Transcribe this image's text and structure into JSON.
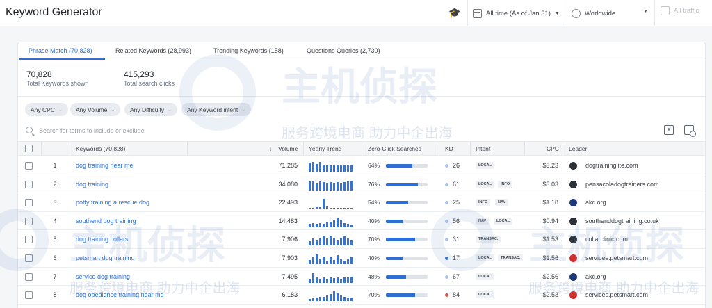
{
  "app": {
    "title": "Keyword Generator"
  },
  "topbar": {
    "date_label": "All time (As of Jan 31)",
    "region_label": "Worldwide",
    "traffic_label": "All traffic"
  },
  "tabs": [
    {
      "label": "Phrase Match (70,828)",
      "active": true
    },
    {
      "label": "Related Keywords (28,993)",
      "active": false
    },
    {
      "label": "Trending Keywords (158)",
      "active": false
    },
    {
      "label": "Questions Queries (2,730)",
      "active": false
    }
  ],
  "stats": [
    {
      "value": "70,828",
      "label": "Total Keywords shown"
    },
    {
      "value": "415,293",
      "label": "Total search clicks"
    }
  ],
  "filters": [
    "Any CPC",
    "Any Volume",
    "Any Difficulty",
    "Any Keyword intent"
  ],
  "search": {
    "placeholder": "Search for terms to include or exclude"
  },
  "table": {
    "headers": {
      "keywords": "Keywords (70,828)",
      "volume": "Volume",
      "trend": "Yearly Trend",
      "zero_click": "Zero-Click Searches",
      "kd": "KD",
      "intent": "Intent",
      "cpc": "CPC",
      "leader": "Leader"
    },
    "rows": [
      {
        "idx": "1",
        "keyword": "dog training near me",
        "volume": "71,285",
        "trend": [
          0.8,
          0.9,
          0.7,
          0.85,
          0.6,
          0.6,
          0.55,
          0.6,
          0.55,
          0.6,
          0.55,
          0.6,
          0.6
        ],
        "zc": "64%",
        "zc_value": 0.64,
        "kd": "26",
        "kd_color": "#a9c2e8",
        "intent": [
          "LOCAL"
        ],
        "cpc": "$3.23",
        "leader": "dogtraininglite.com",
        "leader_icon": "dogtraininglite-logo-icon",
        "leader_color": "#2b2f36"
      },
      {
        "idx": "2",
        "keyword": "dog training",
        "volume": "34,080",
        "trend": [
          0.8,
          0.85,
          0.7,
          0.8,
          0.75,
          0.7,
          0.75,
          0.7,
          0.75,
          0.7,
          0.75,
          0.8,
          0.85
        ],
        "zc": "76%",
        "zc_value": 0.76,
        "kd": "61",
        "kd_color": "#a9c2e8",
        "intent": [
          "LOCAL",
          "INFO"
        ],
        "cpc": "$3.03",
        "leader": "pensacoladogtrainers.com",
        "leader_icon": "pensacola-logo-icon",
        "leader_color": "#2b2f36"
      },
      {
        "idx": "3",
        "keyword": "potty training a rescue dog",
        "volume": "22,493",
        "trend": [
          0.05,
          0.05,
          0.1,
          0.15,
          0.9,
          0.2,
          0.05,
          0.05,
          0.05,
          0.05,
          0.05,
          0.05,
          0.05
        ],
        "zc": "54%",
        "zc_value": 0.54,
        "kd": "25",
        "kd_color": "#a9c2e8",
        "intent": [
          "INFO",
          "NAV"
        ],
        "cpc": "$1.18",
        "leader": "akc.org",
        "leader_icon": "akc-logo-icon",
        "leader_color": "#1e3a7a"
      },
      {
        "idx": "4",
        "keyword": "southend dog training",
        "volume": "14,483",
        "trend": [
          0.3,
          0.35,
          0.3,
          0.4,
          0.3,
          0.45,
          0.5,
          0.6,
          0.9,
          0.7,
          0.4,
          0.3,
          0.25
        ],
        "zc": "40%",
        "zc_value": 0.4,
        "kd": "56",
        "kd_color": "#a9c2e8",
        "intent": [
          "NAV",
          "LOCAL"
        ],
        "cpc": "$0.94",
        "leader": "southenddogtraining.co.uk",
        "leader_icon": "southend-logo-icon",
        "leader_color": "#2b2f36"
      },
      {
        "idx": "5",
        "keyword": "dog training collars",
        "volume": "7,906",
        "trend": [
          0.4,
          0.6,
          0.5,
          0.7,
          0.8,
          0.6,
          0.9,
          0.7,
          0.5,
          0.7,
          0.8,
          0.6,
          0.5
        ],
        "zc": "70%",
        "zc_value": 0.7,
        "kd": "31",
        "kd_color": "#a9c2e8",
        "intent": [
          "TRANSAC."
        ],
        "cpc": "$1.53",
        "leader": "collarclinic.com",
        "leader_icon": "collarclinic-logo-icon",
        "leader_color": "#2b2f36"
      },
      {
        "idx": "6",
        "keyword": "petsmart dog training",
        "volume": "7,903",
        "trend": [
          0.4,
          0.7,
          0.9,
          0.5,
          0.7,
          0.3,
          0.6,
          0.4,
          0.8,
          0.5,
          0.3,
          0.5,
          0.6
        ],
        "zc": "40%",
        "zc_value": 0.4,
        "kd": "17",
        "kd_color": "#2f6fd3",
        "intent": [
          "LOCAL",
          "TRANSAC."
        ],
        "cpc": "$1.56",
        "leader": "services.petsmart.com",
        "leader_icon": "petsmart-logo-icon",
        "leader_color": "#d32f2f"
      },
      {
        "idx": "7",
        "keyword": "service dog training",
        "volume": "7,495",
        "trend": [
          0.3,
          0.9,
          0.5,
          0.4,
          0.5,
          0.4,
          0.5,
          0.45,
          0.5,
          0.4,
          0.5,
          0.5,
          0.55
        ],
        "zc": "48%",
        "zc_value": 0.48,
        "kd": "67",
        "kd_color": "#a9c2e8",
        "intent": [
          "LOCAL"
        ],
        "cpc": "$2.56",
        "leader": "akc.org",
        "leader_icon": "akc-logo-icon",
        "leader_color": "#1e3a7a"
      },
      {
        "idx": "8",
        "keyword": "dog obedience training near me",
        "volume": "6,183",
        "trend": [
          0.2,
          0.25,
          0.3,
          0.35,
          0.4,
          0.5,
          0.6,
          0.9,
          0.7,
          0.5,
          0.4,
          0.3,
          0.3
        ],
        "zc": "70%",
        "zc_value": 0.7,
        "kd": "84",
        "kd_color": "#d9534f",
        "intent": [
          "LOCAL"
        ],
        "cpc": "$2.53",
        "leader": "services.petsmart.com",
        "leader_icon": "petsmart-logo-icon",
        "leader_color": "#d32f2f"
      }
    ]
  },
  "watermark": {
    "main": "主机侦探",
    "sub": "服务跨境电商 助力中企出海"
  }
}
